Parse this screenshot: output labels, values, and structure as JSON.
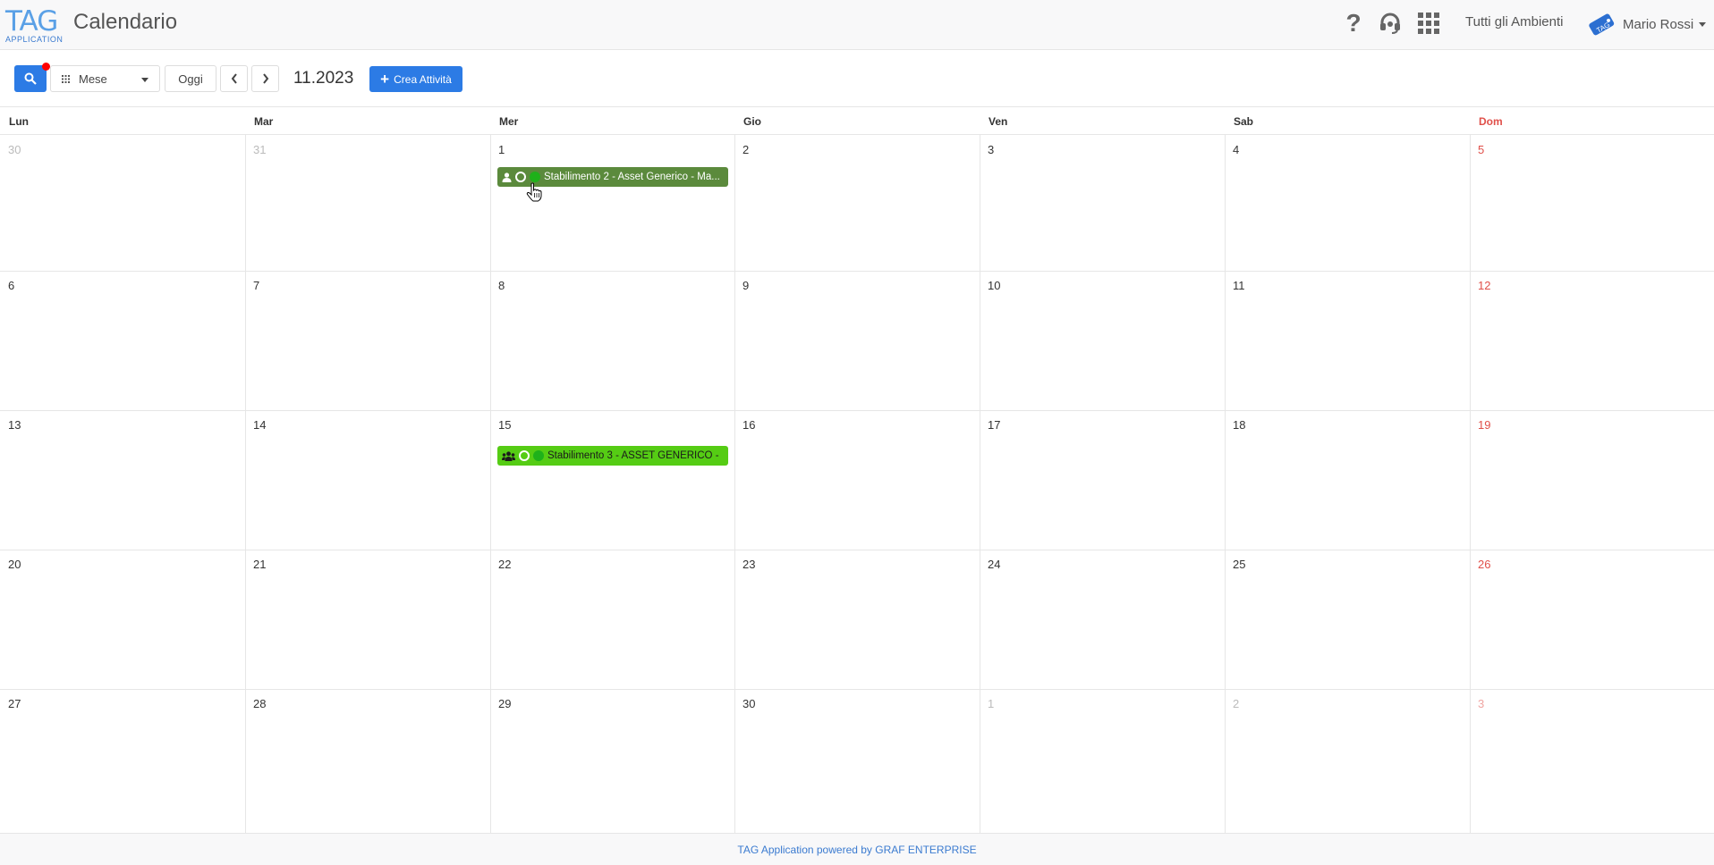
{
  "header": {
    "logo_text": "TAG",
    "logo_subtext": "APPLICATION",
    "title": "Calendario",
    "environments_label": "Tutti gli Ambienti",
    "user_name": "Mario Rossi",
    "avatar_text": "TAG",
    "icons": [
      "help-icon",
      "headset-icon",
      "apps-grid-icon"
    ]
  },
  "toolbar": {
    "view_selected": "Mese",
    "today_label": "Oggi",
    "period": "11.2023",
    "create_label": "Crea Attività"
  },
  "calendar": {
    "weekdays": [
      "Lun",
      "Mar",
      "Mer",
      "Gio",
      "Ven",
      "Sab",
      "Dom"
    ],
    "weeks": [
      [
        {
          "d": "30",
          "muted": true
        },
        {
          "d": "31",
          "muted": true
        },
        {
          "d": "1"
        },
        {
          "d": "2"
        },
        {
          "d": "3"
        },
        {
          "d": "4"
        },
        {
          "d": "5"
        }
      ],
      [
        {
          "d": "6"
        },
        {
          "d": "7"
        },
        {
          "d": "8"
        },
        {
          "d": "9"
        },
        {
          "d": "10"
        },
        {
          "d": "11"
        },
        {
          "d": "12"
        }
      ],
      [
        {
          "d": "13"
        },
        {
          "d": "14"
        },
        {
          "d": "15"
        },
        {
          "d": "16"
        },
        {
          "d": "17"
        },
        {
          "d": "18"
        },
        {
          "d": "19"
        }
      ],
      [
        {
          "d": "20"
        },
        {
          "d": "21"
        },
        {
          "d": "22"
        },
        {
          "d": "23"
        },
        {
          "d": "24"
        },
        {
          "d": "25"
        },
        {
          "d": "26"
        }
      ],
      [
        {
          "d": "27"
        },
        {
          "d": "28"
        },
        {
          "d": "29"
        },
        {
          "d": "30"
        },
        {
          "d": "1",
          "muted": true
        },
        {
          "d": "2",
          "muted": true
        },
        {
          "d": "3",
          "muted": true
        }
      ]
    ],
    "events": [
      {
        "day": "1",
        "title": "Stabilimento 2 - Asset Generico - Ma...",
        "color": "#5b8a3c",
        "icon": "user-icon"
      },
      {
        "day": "15",
        "title": "Stabilimento 3 - ASSET GENERICO -",
        "color": "#55cc14",
        "icon": "users-icon"
      }
    ]
  },
  "footer": {
    "text": "TAG Application powered by GRAF ENTERPRISE"
  },
  "colors": {
    "accent": "#2c7be5",
    "sunday": "#e0504a",
    "notification": "#ff0000"
  }
}
